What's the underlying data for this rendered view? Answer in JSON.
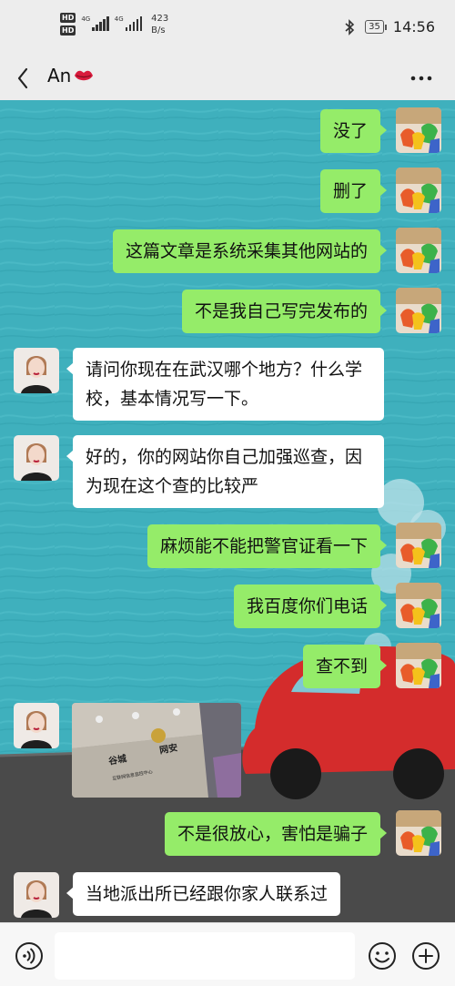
{
  "status_bar": {
    "hd1": "HD",
    "hd2": "HD",
    "sim1_label": "4G",
    "sim2_label": "4G",
    "speed_value": "423",
    "speed_unit": "B/s",
    "battery": "35",
    "time": "14:56"
  },
  "header": {
    "contact_name": "An",
    "name_emoji": "kiss-lips-icon",
    "more_icon": "more-dots-icon",
    "back_icon": "back-chevron-icon"
  },
  "messages": [
    {
      "sender": "me",
      "text": "没了"
    },
    {
      "sender": "me",
      "text": "删了"
    },
    {
      "sender": "me",
      "text": "这篇文章是系统采集其他网站的"
    },
    {
      "sender": "me",
      "text": "不是我自己写完发布的"
    },
    {
      "sender": "other",
      "text": "请问你现在在武汉哪个地方？什么学校，基本情况写一下。"
    },
    {
      "sender": "other",
      "text": "好的，你的网站你自己加强巡查，因为现在这个查的比较严"
    },
    {
      "sender": "me",
      "text": "麻烦能不能把警官证看一下"
    },
    {
      "sender": "me",
      "text": "我百度你们电话"
    },
    {
      "sender": "me",
      "text": "查不到"
    },
    {
      "sender": "other",
      "type": "image",
      "image_texts": [
        "谷城",
        "网安",
        "互联网信息监控中心"
      ]
    },
    {
      "sender": "me",
      "text": "不是很放心，害怕是骗子"
    },
    {
      "sender": "other",
      "text": "当地派出所已经跟你家人联系过"
    }
  ],
  "input_bar": {
    "placeholder": "",
    "voice_icon": "voice-icon",
    "emoji_icon": "emoji-icon",
    "plus_icon": "plus-icon"
  },
  "colors": {
    "my_bubble": "#95ec69",
    "other_bubble": "#ffffff",
    "chat_bg": "#3fb0bd",
    "bar_bg": "#ededed"
  }
}
